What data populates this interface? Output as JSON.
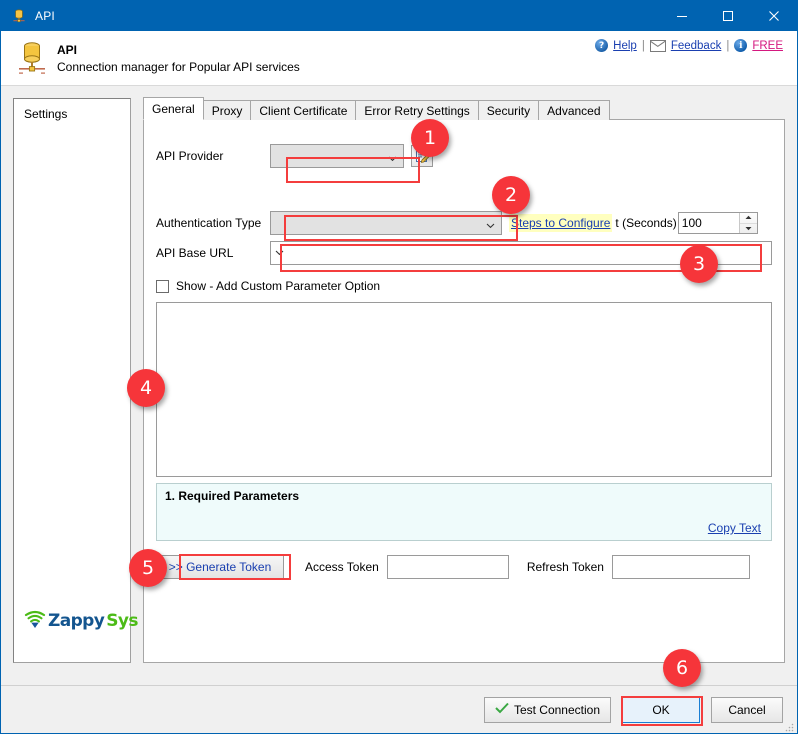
{
  "window": {
    "title": "API",
    "icon": "database-connector-icon",
    "controls": {
      "minimize": "minimize-icon",
      "maximize": "maximize-icon",
      "close": "close-icon"
    }
  },
  "header": {
    "icon": "database-connector-icon",
    "title": "API",
    "subtitle": "Connection manager for Popular API services",
    "links": [
      {
        "icon": "help-icon",
        "label": "Help",
        "color": "#1a3fb0"
      },
      {
        "icon": "mail-icon",
        "label": "Feedback",
        "color": "#1a3fb0"
      },
      {
        "icon": "info-icon",
        "label": "FREE",
        "color": "#d4187f"
      }
    ],
    "separator": "|"
  },
  "sidebar": {
    "items": [
      {
        "label": "Settings"
      }
    ],
    "logo": {
      "icon": "zappysys-signal-icon",
      "part1": "Zappy",
      "part2": "Sys",
      "color1": "#14558f",
      "color2": "#4cbb17"
    }
  },
  "tabs": [
    {
      "label": "General",
      "selected": true
    },
    {
      "label": "Proxy",
      "selected": false
    },
    {
      "label": "Client Certificate",
      "selected": false
    },
    {
      "label": "Error Retry Settings",
      "selected": false
    },
    {
      "label": "Security",
      "selected": false
    },
    {
      "label": "Advanced",
      "selected": false
    }
  ],
  "form": {
    "api_provider": {
      "label": "API Provider",
      "value": "",
      "placeholder": "",
      "edit_icon": "edit-document-icon"
    },
    "auth_type": {
      "label": "Authentication Type",
      "value": "",
      "placeholder": ""
    },
    "steps_link": {
      "label": "Steps to Configure",
      "highlight": "#ffffbf",
      "color": "#1a3fb0"
    },
    "timeout": {
      "label": "t (Seconds)",
      "value": "100"
    },
    "api_base_url": {
      "label": "API Base URL",
      "value": "",
      "placeholder": ""
    },
    "show_custom_param": {
      "label": "Show - Add Custom Parameter Option",
      "checked": false
    },
    "output_panel": {
      "value": ""
    },
    "required_parameters": {
      "title": "1. Required Parameters",
      "copy_link": "Copy Text",
      "background": "#effbfb"
    },
    "generate_token_button": "&gt;&gt; Generate Token",
    "access_token": {
      "label": "Access Token",
      "value": ""
    },
    "refresh_token": {
      "label": "Refresh Token",
      "value": ""
    }
  },
  "footer": {
    "test_connection": {
      "label": "Test Connection",
      "icon": "green-check-icon"
    },
    "ok": {
      "label": "OK",
      "is_default": true
    },
    "cancel": {
      "label": "Cancel"
    },
    "resize_grip": "resize-grip-icon"
  },
  "annotations": {
    "badges": [
      {
        "number": "1"
      },
      {
        "number": "2"
      },
      {
        "number": "3"
      },
      {
        "number": "4"
      },
      {
        "number": "5"
      },
      {
        "number": "6"
      }
    ],
    "color": "#f43d3d"
  }
}
